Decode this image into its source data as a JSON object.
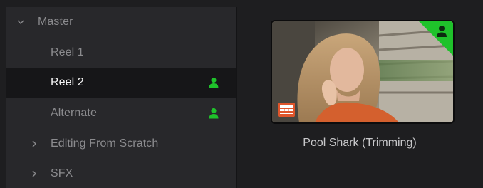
{
  "bins": {
    "items": [
      {
        "label": "Master",
        "expander": "chevron-down",
        "selected": false,
        "shared": false
      },
      {
        "label": "Reel 1",
        "expander": "none",
        "selected": false,
        "shared": false
      },
      {
        "label": "Reel 2",
        "expander": "none",
        "selected": true,
        "shared": true
      },
      {
        "label": "Alternate",
        "expander": "none",
        "selected": false,
        "shared": true
      },
      {
        "label": "Editing From Scratch",
        "expander": "chevron-right",
        "selected": false,
        "shared": false
      },
      {
        "label": "SFX",
        "expander": "chevron-right",
        "selected": false,
        "shared": false
      }
    ]
  },
  "clip": {
    "name": "Pool Shark (Trimming)",
    "badge_icon": "timeline-clip-icon",
    "corner_icon": "shared-user-icon"
  },
  "colors": {
    "accent_green": "#1fc22b",
    "badge_orange": "#e0552b",
    "selected_text": "#f2f2f2",
    "muted_text": "#8b8b8e"
  }
}
